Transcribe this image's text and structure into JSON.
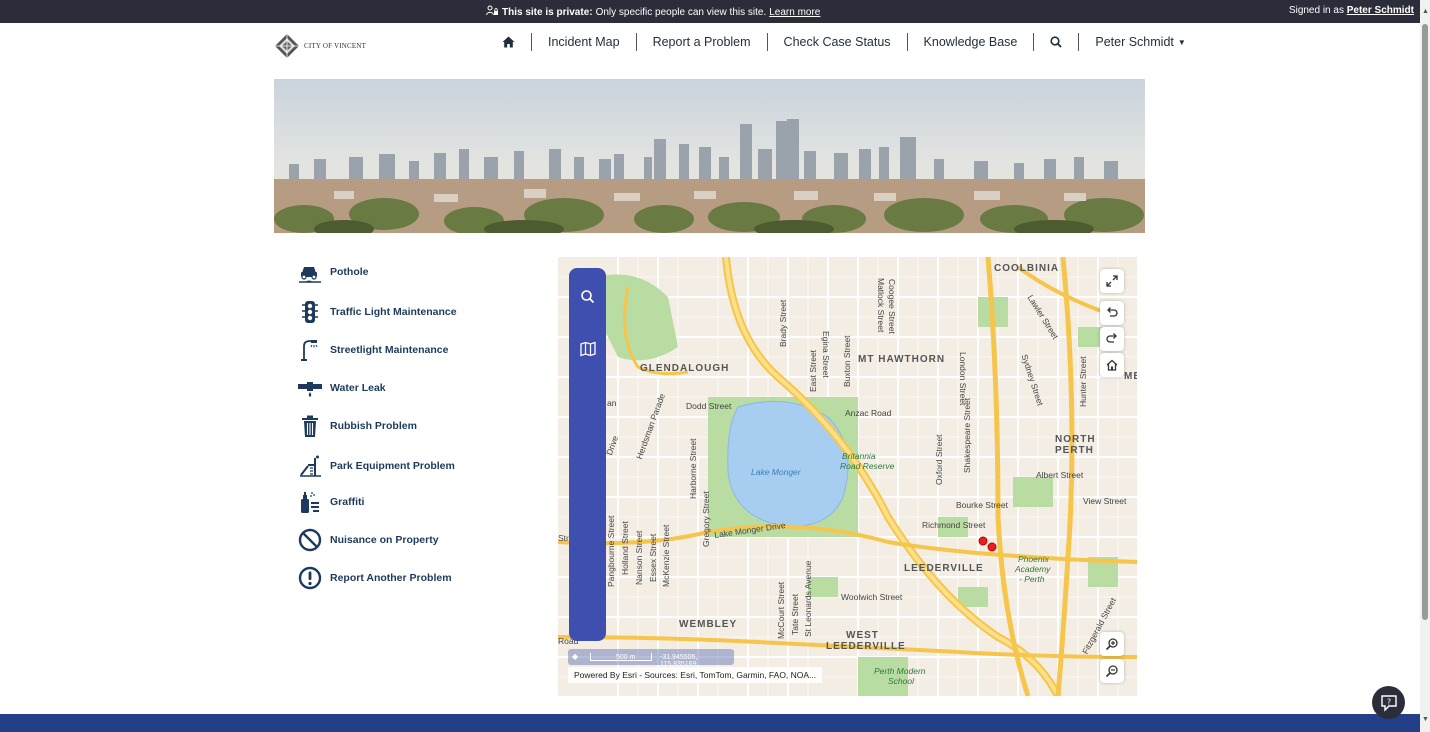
{
  "banner": {
    "bold": "This site is private:",
    "text": "Only specific people can view this site.",
    "link": "Learn more",
    "signed_in_prefix": "Signed in as",
    "signed_in_user": "Peter Schmidt"
  },
  "header": {
    "logo_text": "CITY OF VINCENT",
    "nav": [
      "Incident Map",
      "Report a Problem",
      "Check Case Status",
      "Knowledge Base"
    ],
    "user": "Peter Schmidt"
  },
  "problems": [
    {
      "label": "Pothole",
      "icon": "car-pothole-icon"
    },
    {
      "label": "Traffic Light Maintenance",
      "icon": "traffic-light-icon"
    },
    {
      "label": "Streetlight Maintenance",
      "icon": "streetlight-icon"
    },
    {
      "label": "Water Leak",
      "icon": "water-leak-icon"
    },
    {
      "label": "Rubbish Problem",
      "icon": "trash-icon"
    },
    {
      "label": "Park Equipment Problem",
      "icon": "playground-icon"
    },
    {
      "label": "Graffiti",
      "icon": "spray-can-icon"
    },
    {
      "label": "Nuisance on Property",
      "icon": "prohibited-icon"
    },
    {
      "label": "Report Another Problem",
      "icon": "exclamation-icon"
    }
  ],
  "map": {
    "labels": {
      "coolbinia": "COOLBINIA",
      "glendalough": "GLENDALOUGH",
      "mt_hawthorn": "MT HAWTHORN",
      "north_perth_1": "NORTH",
      "north_perth_2": "PERTH",
      "leederville": "LEEDERVILLE",
      "wembley": "WEMBLEY",
      "west_leederville_1": "WEST",
      "west_leederville_2": "LEEDERVILLE",
      "me": "ME",
      "lake_monger": "Lake Monger",
      "britannia_1": "Britannia",
      "britannia_2": "Road Reserve",
      "phoenix_1": "Phoenix",
      "phoenix_2": "Academy",
      "phoenix_3": "- Perth",
      "perth_modern_1": "Perth Modern",
      "perth_modern_2": "School",
      "dodd": "Dodd Street",
      "anzac": "Anzac Road",
      "albert": "Albert Street",
      "bourke": "Bourke Street",
      "view": "View Street",
      "richmond": "Richmond Street",
      "lake_monger_drive": "Lake Monger Drive",
      "woolwich": "Woolwich Street",
      "london": "London Street",
      "lawler": "Lawler Street",
      "sydney": "Sydney Street",
      "hunter": "Hunter Street",
      "brady": "Brady Street",
      "egina": "Egina Street",
      "matlock": "Matlock Street",
      "coogee": "Coogee Street",
      "east": "East Street",
      "buxton": "Buxton Street",
      "oxford": "Oxford Street",
      "shakespeare": "Shakespeare Street",
      "harborne": "Harborne Street",
      "gregory": "Gregory Street",
      "herdsman": "Herdsman Parade",
      "pangbourne": "Pangbourne Street",
      "holland": "Holland Street",
      "nanson": "Nanson Street",
      "essex": "Essex Street",
      "mckenzie": "McKenzie Street",
      "mccourt": "McCourt Street",
      "tate": "Tate Street",
      "st_leonards": "St Leonards Avenue",
      "fitzgerald": "Fitzgerald Street",
      "drive": "Drive",
      "road": "Road",
      "str": "Str",
      "an": "an"
    },
    "scale_label": "500 m",
    "coordinates": "-31.945506, 115.835169",
    "attribution": "Powered By Esri - Sources: Esri, TomTom, Garmin, FAO, NOA..."
  }
}
